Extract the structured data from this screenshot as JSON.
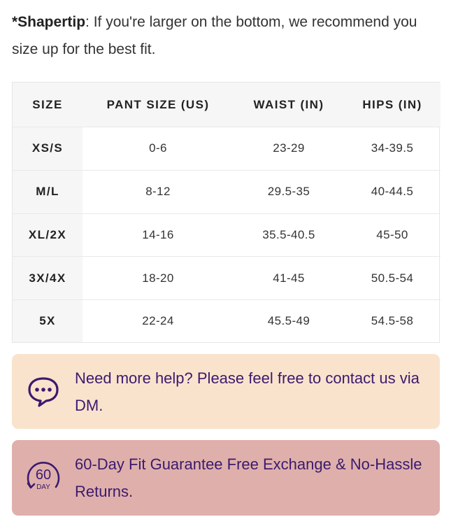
{
  "tip": {
    "label": "*Shapertip",
    "text": ": If you're larger on the bottom, we recommend you size up for the best fit."
  },
  "size_table": {
    "headers": [
      "SIZE",
      "PANT SIZE (US)",
      "WAIST (IN)",
      "HIPS (IN)"
    ],
    "rows": [
      [
        "XS/S",
        "0-6",
        "23-29",
        "34-39.5"
      ],
      [
        "M/L",
        "8-12",
        "29.5-35",
        "40-44.5"
      ],
      [
        "XL/2X",
        "14-16",
        "35.5-40.5",
        "45-50"
      ],
      [
        "3X/4X",
        "18-20",
        "41-45",
        "50.5-54"
      ],
      [
        "5X",
        "22-24",
        "45.5-49",
        "54.5-58"
      ]
    ]
  },
  "help_box": {
    "icon": "chat-bubble-icon",
    "text": "Need more help? Please feel free to contact us via DM.",
    "background": "#fae3cd"
  },
  "guarantee_box": {
    "icon": "sixty-day-icon",
    "icon_number": "60",
    "icon_unit": "DAY",
    "text": "60-Day Fit Guarantee Free Exchange & No-Hassle Returns.",
    "background": "#dfb0ab"
  },
  "colors": {
    "accent_text": "#3b1a6e",
    "header_bg": "#f6f6f6"
  }
}
